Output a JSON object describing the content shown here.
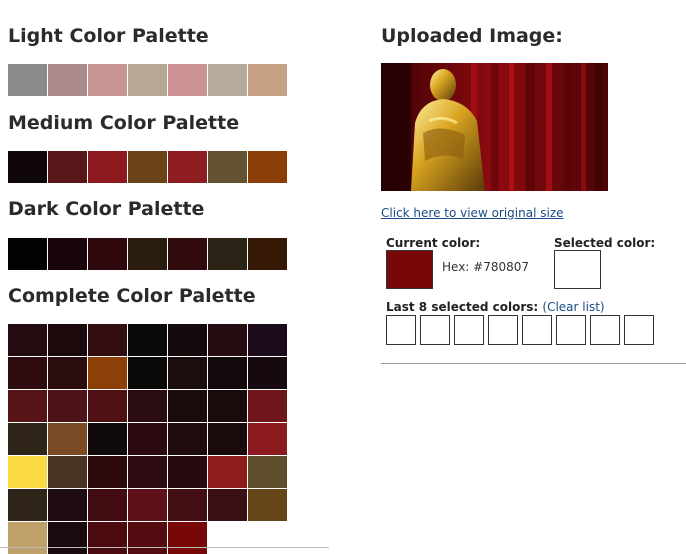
{
  "light": {
    "title": "Light Color Palette",
    "colors": [
      "#8c8a8b",
      "#ac8a8d",
      "#c69594",
      "#b8a793",
      "#cb9193",
      "#b4ab9c",
      "#c7a184"
    ]
  },
  "medium": {
    "title": "Medium Color Palette",
    "colors": [
      "#0e0608",
      "#581618",
      "#8c191d",
      "#6b4319",
      "#8e1e22",
      "#64512f",
      "#8a3e06"
    ]
  },
  "dark": {
    "title": "Dark Color Palette",
    "colors": [
      "#040203",
      "#1a060a",
      "#2e080d",
      "#2a1c0e",
      "#310a0e",
      "#2a2316",
      "#361905"
    ]
  },
  "complete": {
    "title": "Complete Color Palette",
    "colors": [
      "#250c10",
      "#1d0a0c",
      "#320e10",
      "#0b0808",
      "#120a0b",
      "#260d12",
      "#1b0b1b",
      "#2f0c10",
      "#2b0d0e",
      "#8c3f07",
      "#0b0808",
      "#1b0c0e",
      "#130a0b",
      "#160a0e",
      "#561417",
      "#4c1416",
      "#4e1012",
      "#2a0c11",
      "#1a0b0c",
      "#1b0a0c",
      "#6e1619",
      "#302519",
      "#7a4b25",
      "#100a0b",
      "#2c0b10",
      "#1f0a0d",
      "#1b0a0c",
      "#8a1a1d",
      "#fcda46",
      "#4b3522",
      "#2d0a0c",
      "#2d0d12",
      "#260a0e",
      "#8c1c1e",
      "#5f4e2c",
      "#2e2418",
      "#1e0c10",
      "#420c12",
      "#5c1218",
      "#420f15",
      "#3a1014",
      "#664518",
      "#c0a06a",
      "#1a0a0d",
      "#4c0c0f",
      "#540c10",
      "#780807"
    ]
  },
  "uploaded": {
    "title": "Uploaded Image:",
    "view_link": "Click here to view original size"
  },
  "current": {
    "label": "Current color:",
    "hex_text": "Hex: #780807",
    "color": "#780807"
  },
  "selected": {
    "label": "Selected color:"
  },
  "last8": {
    "label": "Last 8 selected colors:",
    "clear": "(Clear list)",
    "count": 8
  }
}
